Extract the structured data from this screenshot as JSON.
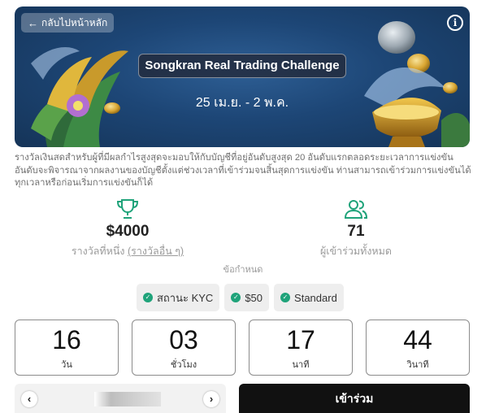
{
  "banner": {
    "back_label": "กลับไปหน้าหลัก",
    "title": "Songkran Real Trading Challenge",
    "dates": "25 เม.ย. - 2 พ.ค.",
    "info_glyph": "i"
  },
  "description": "รางวัลเงินสดสำหรับผู้ที่มีผลกำไรสูงสุดจะมอบให้กับบัญชีที่อยู่อันดับสูงสุด 20 อันดับแรกตลอดระยะเวลาการแข่งขัน อันดับจะพิจารณาจากผลงานของบัญชีตั้งแต่ช่วงเวลาที่เข้าร่วมจนสิ้นสุดการแข่งขัน ท่านสามารถเข้าร่วมการแข่งขันได้ทุกเวลาหรือก่อนเริ่มการแข่งขันก็ได้",
  "stats": {
    "prize": {
      "value": "$4000",
      "label": "รางวัลที่หนึ่ง",
      "link": "(รางวัลอื่น ๆ)",
      "icon": "trophy-icon"
    },
    "participants": {
      "value": "71",
      "label": "ผู้เข้าร่วมทั้งหมด",
      "icon": "users-icon"
    }
  },
  "requirements": {
    "title": "ข้อกำหนด",
    "items": [
      {
        "label": "สถานะ KYC",
        "icon": "check-circle-icon"
      },
      {
        "label": "$50",
        "icon": "check-circle-icon"
      },
      {
        "label": "Standard",
        "icon": "check-circle-icon"
      }
    ],
    "check_glyph": "✓"
  },
  "countdown": [
    {
      "value": "16",
      "unit": "วัน"
    },
    {
      "value": "03",
      "unit": "ชั่วโมง"
    },
    {
      "value": "17",
      "unit": "นาที"
    },
    {
      "value": "44",
      "unit": "วินาที"
    }
  ],
  "pager": {
    "prev_glyph": "‹",
    "next_glyph": "›"
  },
  "join_label": "เข้าร่วม",
  "colors": {
    "accent": "#1fa37a",
    "banner": "#1d4676",
    "button": "#111111"
  }
}
